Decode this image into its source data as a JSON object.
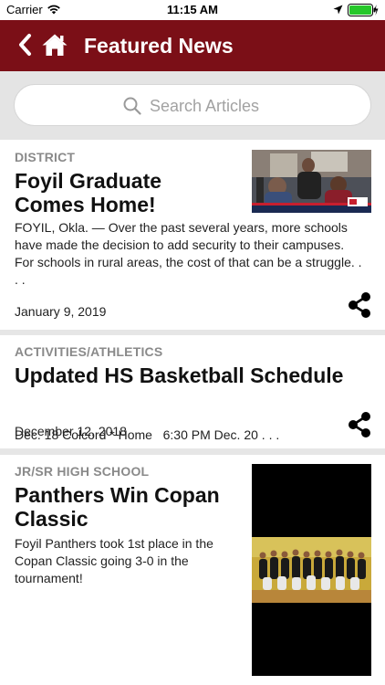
{
  "status_bar": {
    "carrier": "Carrier",
    "time": "11:15 AM",
    "icons": [
      "wifi-icon",
      "location-icon",
      "battery-icon"
    ]
  },
  "nav": {
    "title": "Featured News",
    "icons": [
      "back-chevron-icon",
      "home-icon"
    ],
    "background_color": "#7b0f17"
  },
  "search": {
    "placeholder": "Search Articles",
    "value": ""
  },
  "articles": [
    {
      "category": "DISTRICT",
      "headline_line1": "Foyil Graduate",
      "headline_line2": "Comes Home!",
      "snippet_line1": "FOYIL, Okla. — Over the past several years, more schools",
      "snippet_line2": "have made the decision to add security to their campuses.",
      "snippet_line3": "For schools in rural areas, the cost of that can be a struggle. .",
      "snippet_line4": ". .",
      "date": "January 9, 2019",
      "has_image": true
    },
    {
      "category": "ACTIVITIES/ATHLETICS",
      "headline_line1": "Updated HS Basketball Schedule",
      "snippet_line1": "Dec. 18 Colcord * Home   6:30 PM Dec. 20 . . .",
      "date": "December 12, 2018",
      "has_image": false
    },
    {
      "category": "JR/SR HIGH SCHOOL",
      "headline_line1": "Panthers Win Copan",
      "headline_line2": "Classic",
      "snippet_line1": "Foyil Panthers took 1st place in the",
      "snippet_line2": "Copan Classic going 3-0 in the",
      "snippet_line3": "tournament!",
      "has_image": true
    }
  ],
  "colors": {
    "accent": "#7b0f17",
    "category_text": "#8a8a8a",
    "divider": "#e0e0e0"
  }
}
